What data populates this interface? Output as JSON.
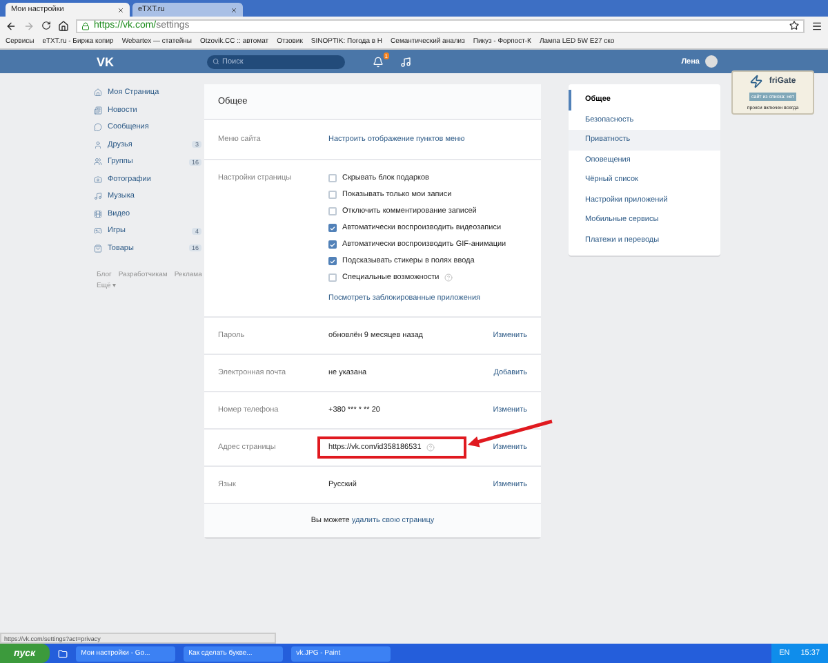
{
  "browser": {
    "tabs": [
      {
        "title": "Мои настройки",
        "selected": true
      },
      {
        "title": "eTXT.ru",
        "selected": false
      }
    ],
    "url_host": "https://vk.com/",
    "url_path": "settings",
    "bookmarks": [
      "Сервисы",
      "eTXT.ru - Биржа копир",
      "Webartex — статейны",
      "Otzovik.CC :: автомат",
      "Отзовик",
      "SINOPTIK: Погода в Н",
      "Семантический анализ",
      "Пикуз - Форпост-К",
      "Лампа LED 5W E27 ско"
    ]
  },
  "header": {
    "logo": "VK",
    "search": {
      "placeholder": "Поиск"
    },
    "notifications": "1",
    "user": "Лена"
  },
  "sidebar": {
    "items": [
      {
        "label": "Моя Страница"
      },
      {
        "label": "Новости"
      },
      {
        "label": "Сообщения"
      },
      {
        "label": "Друзья",
        "count": "3"
      },
      {
        "label": "Группы",
        "count": "16"
      },
      {
        "label": "Фотографии"
      },
      {
        "label": "Музыка"
      },
      {
        "label": "Видео"
      },
      {
        "label": "Игры",
        "count": "4"
      },
      {
        "label": "Товары",
        "count": "16"
      }
    ],
    "footer_links": [
      "Блог",
      "Разработчикам",
      "Реклама",
      "Ещё ▾"
    ]
  },
  "settings": {
    "title": "Общее",
    "rows": [
      {
        "kind": "link",
        "label": "Меню сайта",
        "value": "Настроить отображение пунктов меню"
      },
      {
        "kind": "checkboxes",
        "label": "Настройки страницы",
        "options": [
          {
            "label": "Скрывать блок подарков",
            "checked": false
          },
          {
            "label": "Показывать только мои записи",
            "checked": false
          },
          {
            "label": "Отключить комментирование записей",
            "checked": false
          },
          {
            "label": "Автоматически воспроизводить видеозаписи",
            "checked": true
          },
          {
            "label": "Автоматически воспроизводить GIF-анимации",
            "checked": true
          },
          {
            "label": "Подсказывать стикеры в полях ввода",
            "checked": true
          },
          {
            "label": "Специальные возможности",
            "checked": false,
            "help": true
          }
        ],
        "link": "Посмотреть заблокированные приложения"
      },
      {
        "kind": "value",
        "label": "Пароль",
        "value": "обновлён 9 месяцев назад",
        "action": "Изменить"
      },
      {
        "kind": "value",
        "label": "Электронная почта",
        "value": "не указана",
        "action": "Добавить"
      },
      {
        "kind": "value",
        "label": "Номер телефона",
        "value": "+380 *** * ** 20",
        "action": "Изменить"
      },
      {
        "kind": "address",
        "label": "Адрес страницы",
        "value": "https://vk.com/id358186531",
        "action": "Изменить",
        "highlighted": true
      },
      {
        "kind": "value",
        "label": "Язык",
        "value": "Русский",
        "action": "Изменить"
      }
    ],
    "footer_text": "Вы можете",
    "footer_link": "удалить свою страницу"
  },
  "menu": [
    {
      "label": "Общее",
      "selected": true,
      "hovered": false
    },
    {
      "label": "Безопасность",
      "selected": false,
      "hovered": false
    },
    {
      "label": "Приватность",
      "selected": false,
      "hovered": true
    },
    {
      "label": "Оповещения",
      "selected": false,
      "hovered": false
    },
    {
      "label": "Чёрный список",
      "selected": false,
      "hovered": false
    },
    {
      "label": "Настройки приложений",
      "selected": false,
      "hovered": false
    },
    {
      "label": "Мобильные сервисы",
      "selected": false,
      "hovered": false
    },
    {
      "label": "Платежи и переводы",
      "selected": false,
      "hovered": false
    }
  ],
  "frigate": {
    "title": "friGate",
    "status": "сайт из списка: нет",
    "proxy": "прокси включен всегда"
  },
  "status_url": "https://vk.com/settings?act=privacy",
  "taskbar": {
    "start": "пуск",
    "windows": [
      "Мои настройки - Go...",
      "Как сделать букве...",
      "vk.JPG - Paint"
    ],
    "lang": "EN",
    "time": "15:37"
  }
}
